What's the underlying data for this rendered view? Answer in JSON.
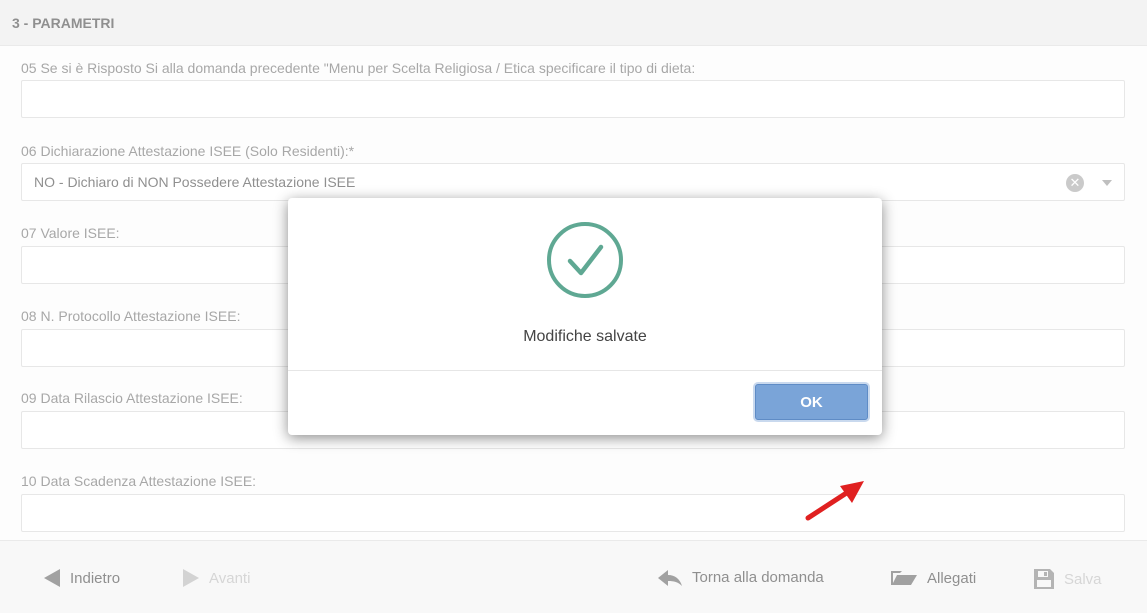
{
  "section": {
    "title": "3 - PARAMETRI"
  },
  "fields": [
    {
      "label": "05 Se si è Risposto Si alla domanda precedente \"Menu per Scelta Religiosa / Etica specificare il tipo di dieta:",
      "value": ""
    },
    {
      "label": "06 Dichiarazione Attestazione ISEE (Solo Residenti):*",
      "value": "NO - Dichiaro di NON Possedere Attestazione ISEE"
    },
    {
      "label": "07 Valore ISEE:",
      "value": ""
    },
    {
      "label": "08 N. Protocollo Attestazione ISEE:",
      "value": ""
    },
    {
      "label": "09 Data Rilascio Attestazione ISEE:",
      "value": ""
    },
    {
      "label": "10 Data Scadenza Attestazione ISEE:",
      "value": ""
    }
  ],
  "select_icons": {
    "clear": "clear-icon",
    "toggle": "chevron-down-icon",
    "clear_glyph": "✕"
  },
  "footer": {
    "back_label": "Indietro",
    "next_label": "Avanti",
    "return_label": "Torna alla domanda",
    "attachments_label": "Allegati",
    "save_label": "Salva"
  },
  "modal": {
    "message": "Modifiche salvate",
    "ok_label": "OK",
    "icon": "check-circle-icon"
  },
  "colors": {
    "success": "#5fa893",
    "ok_button": "#7aa4d8",
    "annotation": "#e02020"
  }
}
